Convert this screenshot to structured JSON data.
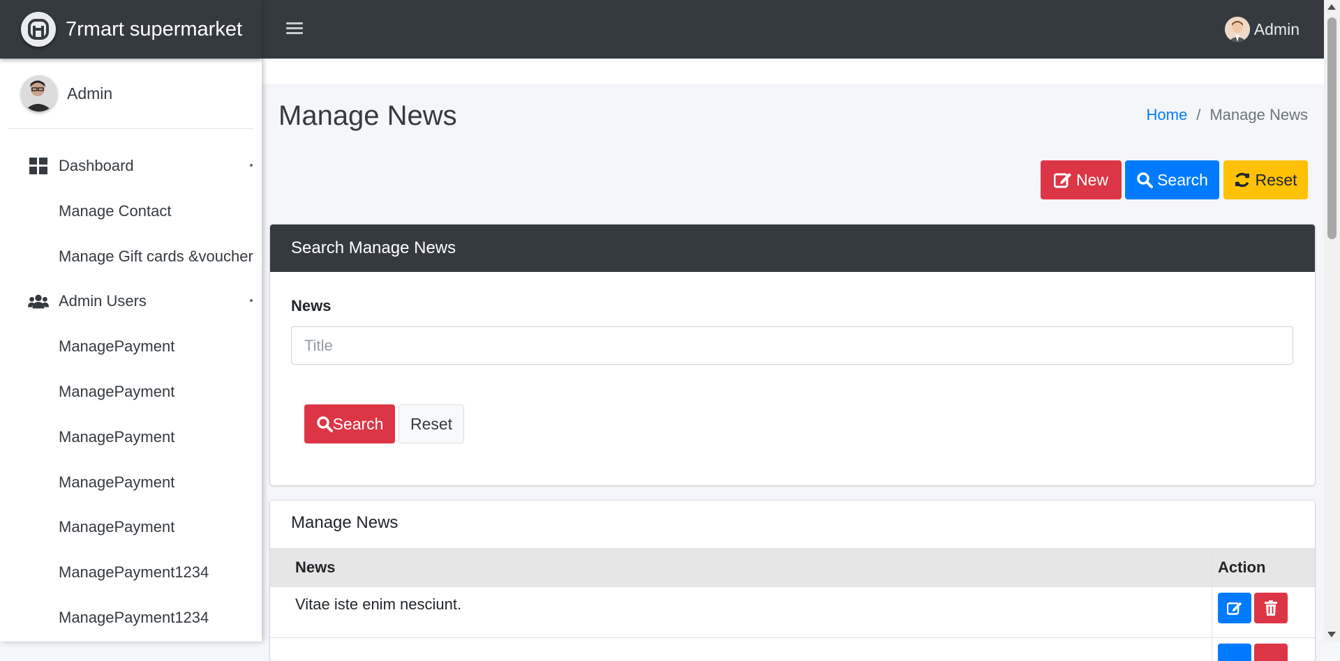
{
  "brand": {
    "name": "7rmart supermarket",
    "logo_icon": "brand-logo-icon"
  },
  "topbar": {
    "user_name": "Admin"
  },
  "sidebar": {
    "user_name": "Admin",
    "items": [
      {
        "label": "Dashboard",
        "icon": "dashboard-icon"
      },
      {
        "label": "Manage Contact"
      },
      {
        "label": "Manage Gift cards &voucher"
      },
      {
        "label": "Admin Users",
        "icon": "users-icon"
      },
      {
        "label": "ManagePayment"
      },
      {
        "label": "ManagePayment"
      },
      {
        "label": "ManagePayment"
      },
      {
        "label": "ManagePayment"
      },
      {
        "label": "ManagePayment"
      },
      {
        "label": "ManagePayment1234"
      },
      {
        "label": "ManagePayment1234"
      }
    ]
  },
  "page": {
    "title": "Manage News",
    "breadcrumb": {
      "home": "Home",
      "current": "Manage News"
    }
  },
  "actions": {
    "new": "New",
    "search": "Search",
    "reset": "Reset"
  },
  "search_card": {
    "header": "Search Manage News",
    "field_label": "News",
    "placeholder": "Title",
    "search_button": "Search",
    "reset_button": "Reset"
  },
  "list_card": {
    "title": "Manage News",
    "columns": [
      "News",
      "Action"
    ],
    "rows": [
      {
        "news": "Vitae iste enim nesciunt."
      },
      {
        "news": ""
      }
    ]
  },
  "colors": {
    "danger": "#dc3545",
    "primary": "#007bff",
    "warning": "#ffc107",
    "dark": "#343a40"
  }
}
